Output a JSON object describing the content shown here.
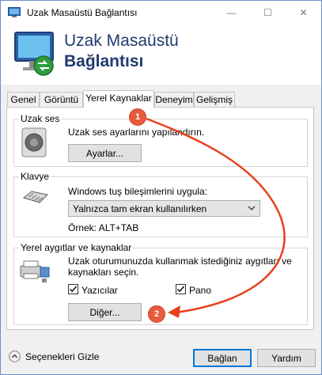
{
  "window": {
    "title": "Uzak Masaüstü Bağlantısı",
    "controls": {
      "minimize": "—",
      "maximize": "☐",
      "close": "✕"
    }
  },
  "banner": {
    "line1": "Uzak Masaüstü",
    "line2": "Bağlantısı"
  },
  "tabs": [
    {
      "label": "Genel"
    },
    {
      "label": "Görüntü"
    },
    {
      "label": "Yerel Kaynaklar"
    },
    {
      "label": "Deneyim"
    },
    {
      "label": "Gelişmiş"
    }
  ],
  "remote_audio": {
    "title": "Uzak ses",
    "description": "Uzak ses ayarlarını yapılandırın.",
    "button": "Ayarlar..."
  },
  "keyboard": {
    "title": "Klavye",
    "description": "Windows tuş bileşimlerini uygula:",
    "selected": "Yalnızca tam ekran kullanılırken",
    "example": "Örnek: ALT+TAB"
  },
  "local_devices": {
    "title": "Yerel aygıtlar ve kaynaklar",
    "description_line1": "Uzak oturumunuzda kullanmak istediğiniz aygıtları ve",
    "description_line2": "kaynakları seçin.",
    "printers_label": "Yazıcılar",
    "printers_checked": true,
    "clipboard_label": "Pano",
    "clipboard_checked": true,
    "more_button": "Diğer..."
  },
  "annotations": {
    "badge1": "1",
    "badge2": "2",
    "color": "#e8401c"
  },
  "footer": {
    "hide_options": "Seçenekleri Gizle",
    "connect": "Bağlan",
    "help": "Yardım"
  }
}
